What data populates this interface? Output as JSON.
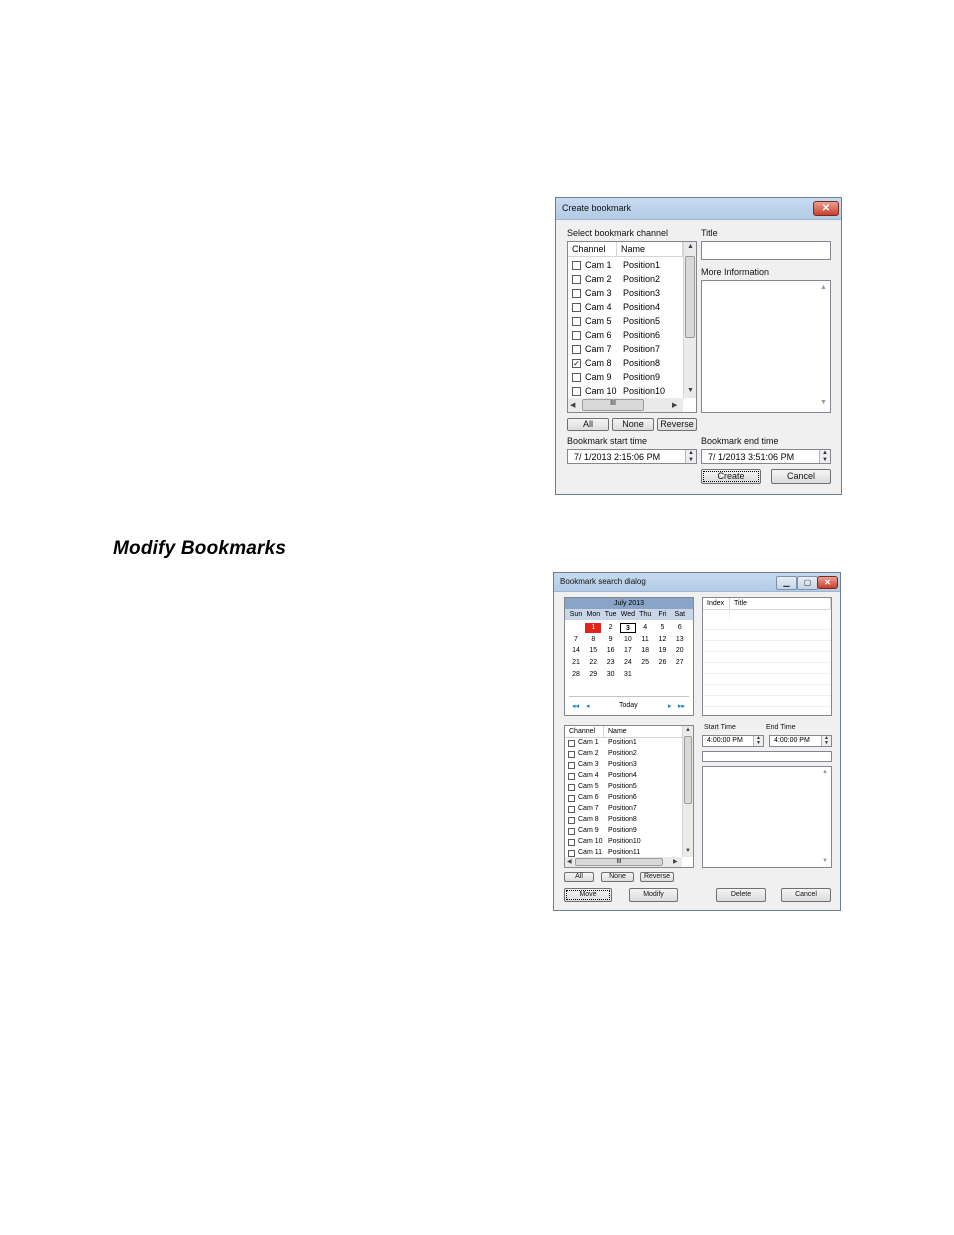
{
  "heading": "Modify Bookmarks",
  "create": {
    "title": "Create bookmark",
    "close_glyph": "✕",
    "select_label": "Select bookmark channel",
    "col_channel": "Channel",
    "col_name": "Name",
    "rows": [
      {
        "channel": "Cam 1",
        "name": "Position1",
        "checked": false
      },
      {
        "channel": "Cam 2",
        "name": "Position2",
        "checked": false
      },
      {
        "channel": "Cam 3",
        "name": "Position3",
        "checked": false
      },
      {
        "channel": "Cam 4",
        "name": "Position4",
        "checked": false
      },
      {
        "channel": "Cam 5",
        "name": "Position5",
        "checked": false
      },
      {
        "channel": "Cam 6",
        "name": "Position6",
        "checked": false
      },
      {
        "channel": "Cam 7",
        "name": "Position7",
        "checked": false
      },
      {
        "channel": "Cam 8",
        "name": "Position8",
        "checked": true
      },
      {
        "channel": "Cam 9",
        "name": "Position9",
        "checked": false
      },
      {
        "channel": "Cam 10",
        "name": "Position10",
        "checked": false
      }
    ],
    "title_label": "Title",
    "title_value": "",
    "more_label": "More Information",
    "btn_all": "All",
    "btn_none": "None",
    "btn_reverse": "Reverse",
    "start_label": "Bookmark start time",
    "start_value": "7/ 1/2013   2:15:06 PM",
    "end_label": "Bookmark end time",
    "end_value": "7/ 1/2013   3:51:06 PM",
    "btn_create": "Create",
    "btn_cancel": "Cancel",
    "hscroll_grip": "III"
  },
  "search": {
    "title": "Bookmark search dialog",
    "min_glyph": "▁",
    "max_glyph": "▢",
    "close_glyph": "✕",
    "month": "July 2013",
    "day_names": [
      "Sun",
      "Mon",
      "Tue",
      "Wed",
      "Thu",
      "Fri",
      "Sat"
    ],
    "weeks": [
      [
        "",
        "1",
        "2",
        "3",
        "4",
        "5",
        "6"
      ],
      [
        "7",
        "8",
        "9",
        "10",
        "11",
        "12",
        "13"
      ],
      [
        "14",
        "15",
        "16",
        "17",
        "18",
        "19",
        "20"
      ],
      [
        "21",
        "22",
        "23",
        "24",
        "25",
        "26",
        "27"
      ],
      [
        "28",
        "29",
        "30",
        "31",
        "",
        "",
        ""
      ]
    ],
    "highlighted_day": "1",
    "boxed_day": "3",
    "nav_prev_year": "◂◂",
    "nav_prev": "◂",
    "nav_today": "Today",
    "nav_next": "▸",
    "nav_next_year": "▸▸",
    "col_index": "Index",
    "col_title": "Title",
    "col_channel": "Channel",
    "col_name": "Name",
    "rows": [
      {
        "channel": "Cam 1",
        "name": "Position1"
      },
      {
        "channel": "Cam 2",
        "name": "Position2"
      },
      {
        "channel": "Cam 3",
        "name": "Position3"
      },
      {
        "channel": "Cam 4",
        "name": "Position4"
      },
      {
        "channel": "Cam 5",
        "name": "Position5"
      },
      {
        "channel": "Cam 6",
        "name": "Position6"
      },
      {
        "channel": "Cam 7",
        "name": "Position7"
      },
      {
        "channel": "Cam 8",
        "name": "Position8"
      },
      {
        "channel": "Cam 9",
        "name": "Position9"
      },
      {
        "channel": "Cam 10",
        "name": "Position10"
      },
      {
        "channel": "Cam 11",
        "name": "Position11"
      }
    ],
    "start_label": "Start Time",
    "start_value": "4:00:00 PM",
    "end_label": "End Time",
    "end_value": "4:00:00 PM",
    "btn_all": "All",
    "btn_none": "None",
    "btn_reverse": "Reverse",
    "btn_move": "Move",
    "btn_modify": "Modify",
    "btn_delete": "Delete",
    "btn_cancel": "Cancel",
    "hscroll_grip": "III"
  }
}
